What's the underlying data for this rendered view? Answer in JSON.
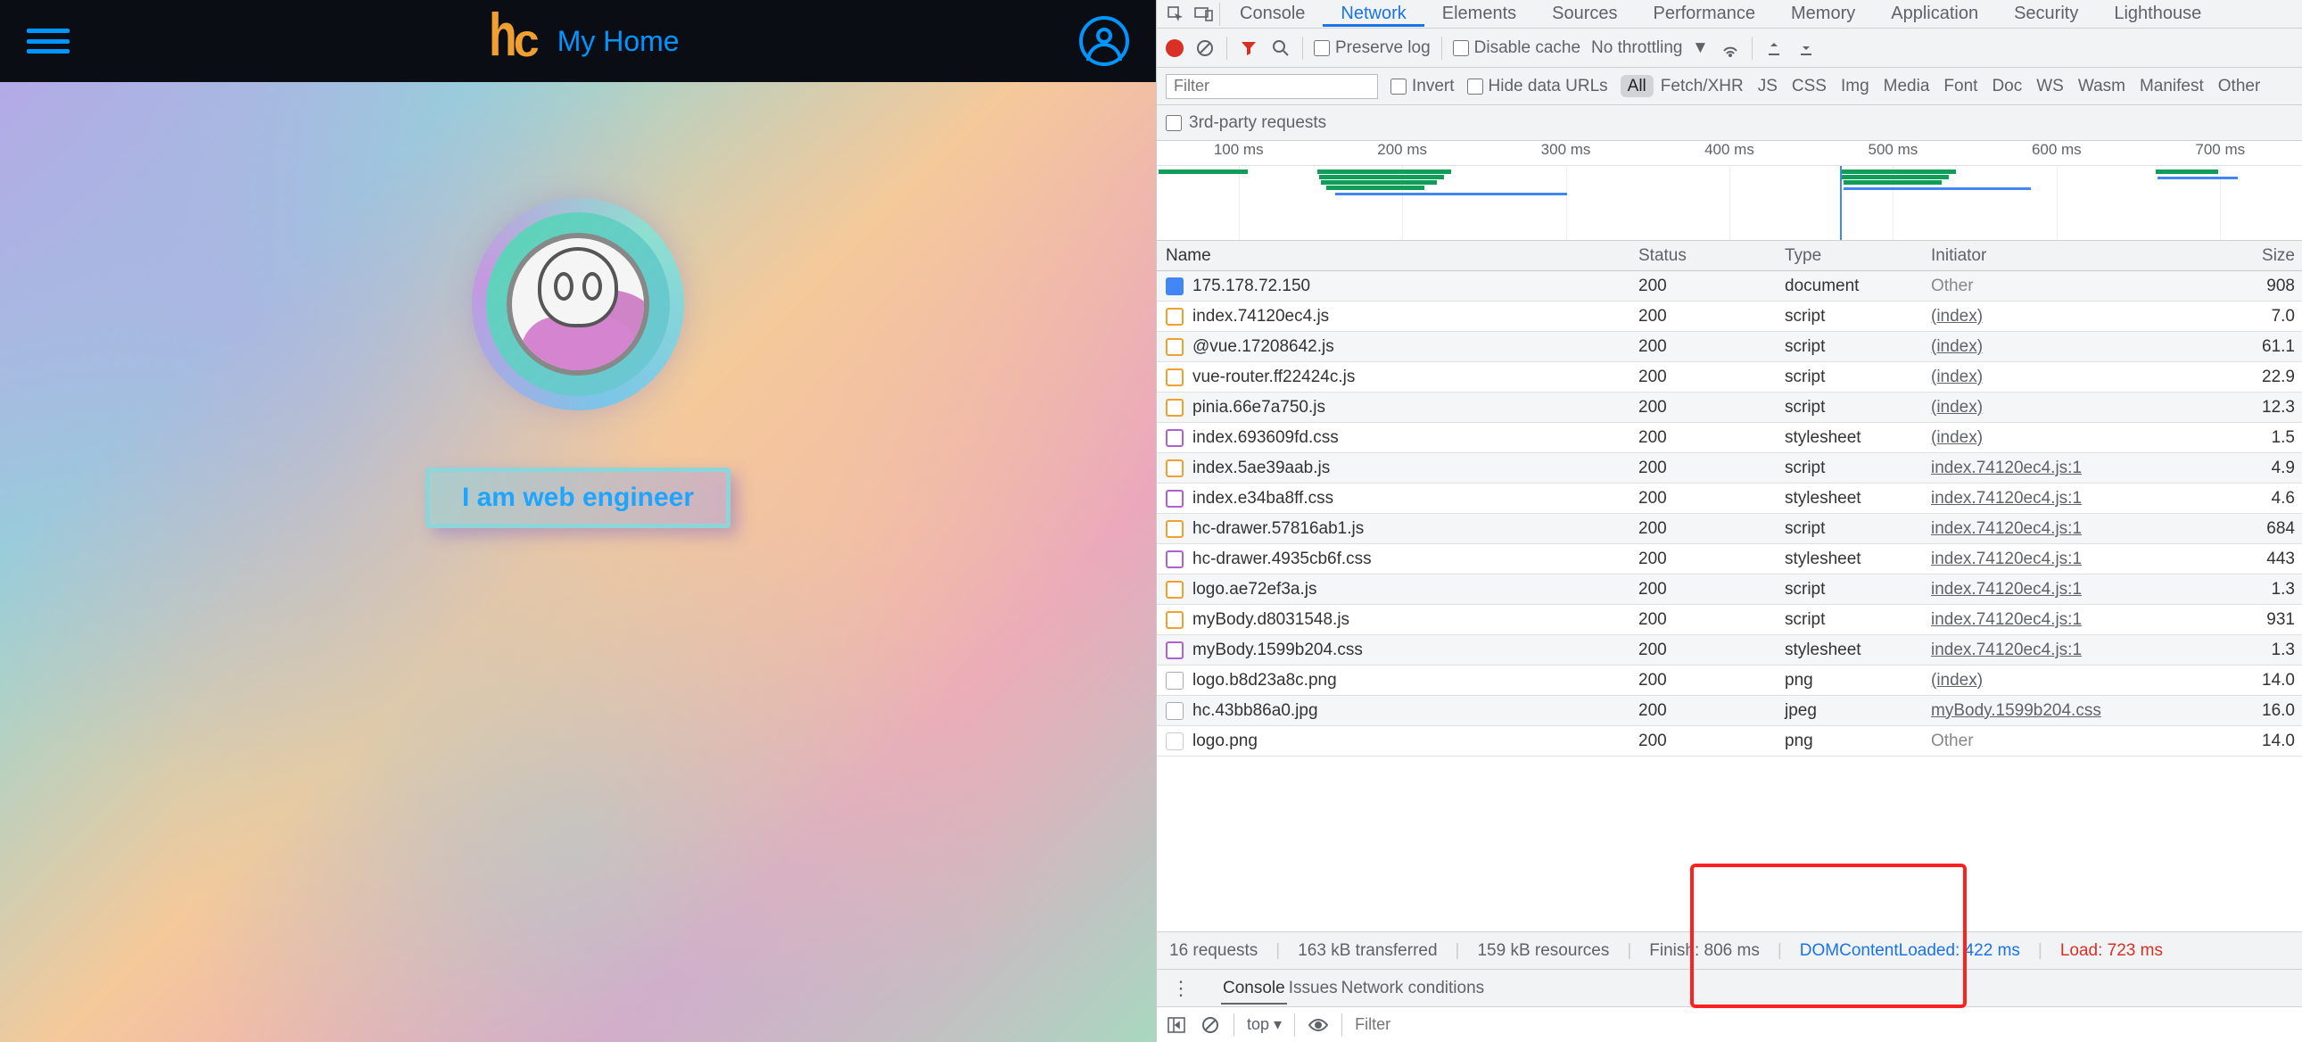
{
  "app": {
    "logo": "hc",
    "title": "My Home",
    "slogan": "I am web engineer"
  },
  "devtools": {
    "tabs": [
      "Console",
      "Network",
      "Elements",
      "Sources",
      "Performance",
      "Memory",
      "Application",
      "Security",
      "Lighthouse"
    ],
    "active_tab": "Network",
    "toolbar": {
      "preserve_log": "Preserve log",
      "disable_cache": "Disable cache",
      "throttling": "No throttling"
    },
    "filter": {
      "placeholder": "Filter",
      "invert": "Invert",
      "hide_data_urls": "Hide data URLs",
      "third_party": "3rd-party requests",
      "types": [
        "All",
        "Fetch/XHR",
        "JS",
        "CSS",
        "Img",
        "Media",
        "Font",
        "Doc",
        "WS",
        "Wasm",
        "Manifest",
        "Other"
      ],
      "active_type": "All"
    },
    "timeline_ticks": [
      "100 ms",
      "200 ms",
      "300 ms",
      "400 ms",
      "500 ms",
      "600 ms",
      "700 ms"
    ],
    "columns": {
      "name": "Name",
      "status": "Status",
      "type": "Type",
      "initiator": "Initiator",
      "size": "Size"
    },
    "requests": [
      {
        "ico": "doc",
        "name": "175.178.72.150",
        "status": "200",
        "type": "document",
        "initiator": "Other",
        "init_link": false,
        "size": "908"
      },
      {
        "ico": "js",
        "name": "index.74120ec4.js",
        "status": "200",
        "type": "script",
        "initiator": "(index)",
        "init_link": true,
        "size": "7.0"
      },
      {
        "ico": "js",
        "name": "@vue.17208642.js",
        "status": "200",
        "type": "script",
        "initiator": "(index)",
        "init_link": true,
        "size": "61.1"
      },
      {
        "ico": "js",
        "name": "vue-router.ff22424c.js",
        "status": "200",
        "type": "script",
        "initiator": "(index)",
        "init_link": true,
        "size": "22.9"
      },
      {
        "ico": "js",
        "name": "pinia.66e7a750.js",
        "status": "200",
        "type": "script",
        "initiator": "(index)",
        "init_link": true,
        "size": "12.3"
      },
      {
        "ico": "css",
        "name": "index.693609fd.css",
        "status": "200",
        "type": "stylesheet",
        "initiator": "(index)",
        "init_link": true,
        "size": "1.5"
      },
      {
        "ico": "js",
        "name": "index.5ae39aab.js",
        "status": "200",
        "type": "script",
        "initiator": "index.74120ec4.js:1",
        "init_link": true,
        "size": "4.9"
      },
      {
        "ico": "css",
        "name": "index.e34ba8ff.css",
        "status": "200",
        "type": "stylesheet",
        "initiator": "index.74120ec4.js:1",
        "init_link": true,
        "size": "4.6"
      },
      {
        "ico": "js",
        "name": "hc-drawer.57816ab1.js",
        "status": "200",
        "type": "script",
        "initiator": "index.74120ec4.js:1",
        "init_link": true,
        "size": "684"
      },
      {
        "ico": "css",
        "name": "hc-drawer.4935cb6f.css",
        "status": "200",
        "type": "stylesheet",
        "initiator": "index.74120ec4.js:1",
        "init_link": true,
        "size": "443"
      },
      {
        "ico": "js",
        "name": "logo.ae72ef3a.js",
        "status": "200",
        "type": "script",
        "initiator": "index.74120ec4.js:1",
        "init_link": true,
        "size": "1.3"
      },
      {
        "ico": "js",
        "name": "myBody.d8031548.js",
        "status": "200",
        "type": "script",
        "initiator": "index.74120ec4.js:1",
        "init_link": true,
        "size": "931"
      },
      {
        "ico": "css",
        "name": "myBody.1599b204.css",
        "status": "200",
        "type": "stylesheet",
        "initiator": "index.74120ec4.js:1",
        "init_link": true,
        "size": "1.3"
      },
      {
        "ico": "img",
        "name": "logo.b8d23a8c.png",
        "status": "200",
        "type": "png",
        "initiator": "(index)",
        "init_link": true,
        "size": "14.0"
      },
      {
        "ico": "img",
        "name": "hc.43bb86a0.jpg",
        "status": "200",
        "type": "jpeg",
        "initiator": "myBody.1599b204.css",
        "init_link": true,
        "size": "16.0"
      },
      {
        "ico": "unk",
        "name": "logo.png",
        "status": "200",
        "type": "png",
        "initiator": "Other",
        "init_link": false,
        "size": "14.0"
      }
    ],
    "status": {
      "requests": "16 requests",
      "transferred": "163 kB transferred",
      "resources": "159 kB resources",
      "finish": "Finish: 806 ms",
      "dom": "DOMContentLoaded: 422 ms",
      "load": "Load: 723 ms"
    },
    "drawer": {
      "tabs": [
        "Console",
        "Issues",
        "Network conditions"
      ],
      "active": "Console",
      "top": "top",
      "filter_placeholder": "Filter"
    }
  }
}
